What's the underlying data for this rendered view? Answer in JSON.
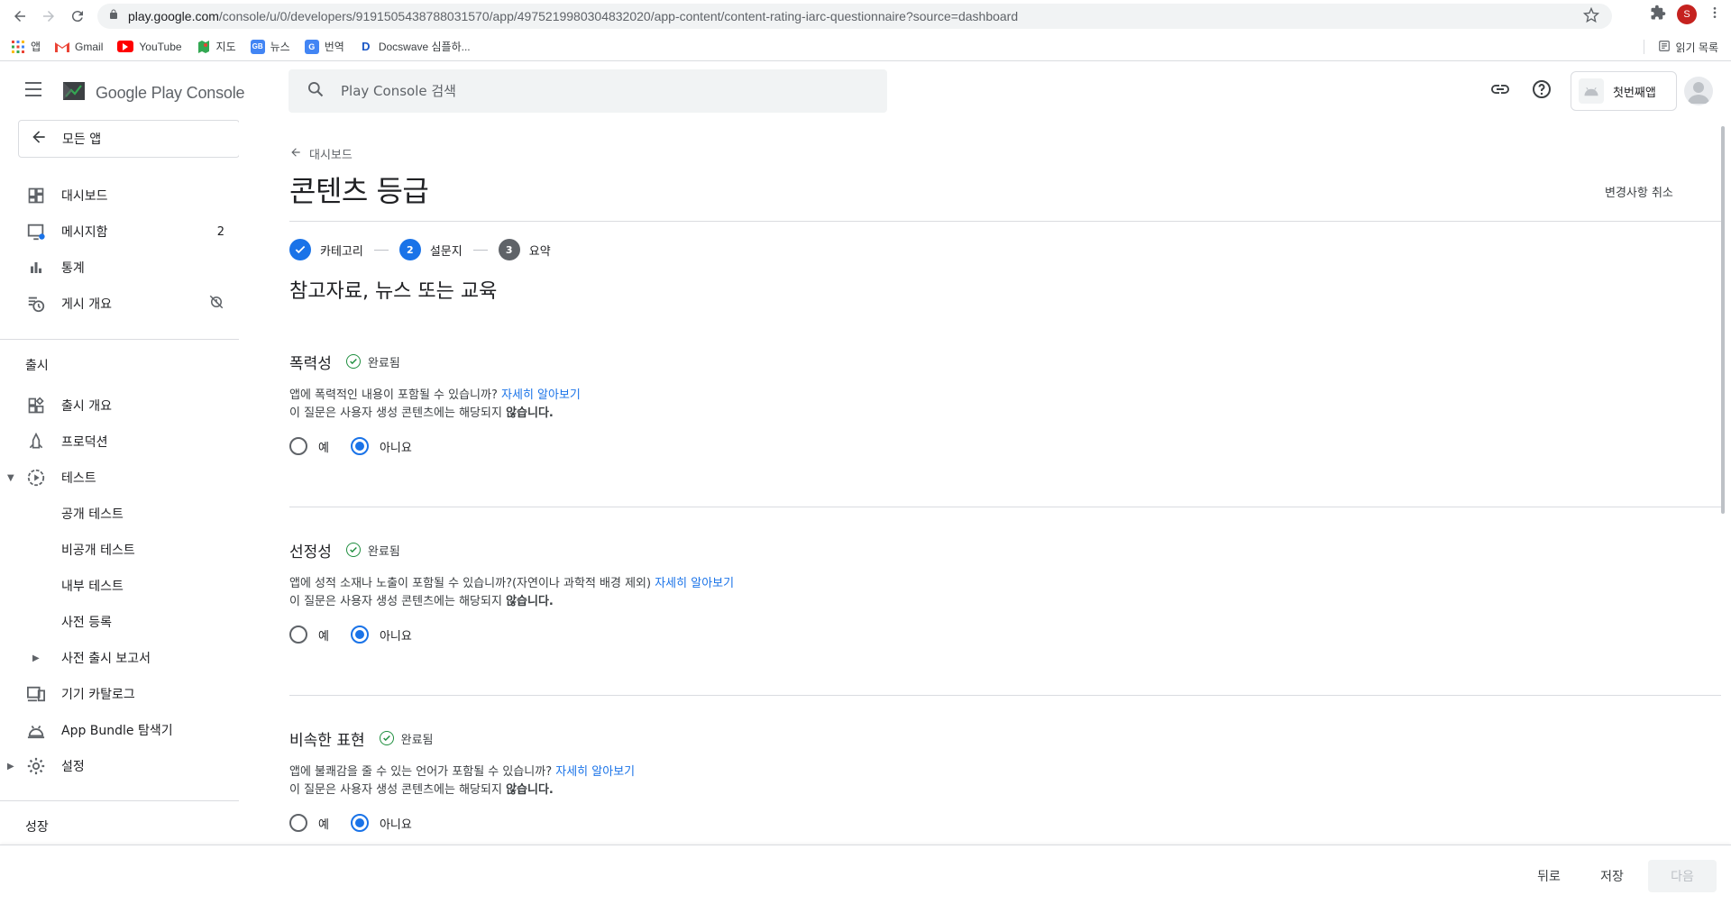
{
  "browser": {
    "url_domain": "play.google.com",
    "url_path": "/console/u/0/developers/9191505438788031570/app/4975219980304832020/app-content/content-rating-iarc-questionnaire?source=dashboard",
    "profile_initial": "S",
    "bookmarks": [
      {
        "label": "앱",
        "icon": "apps-grid-icon"
      },
      {
        "label": "Gmail",
        "icon": "gmail-icon"
      },
      {
        "label": "YouTube",
        "icon": "youtube-icon"
      },
      {
        "label": "지도",
        "icon": "maps-icon"
      },
      {
        "label": "뉴스",
        "icon": "news-icon"
      },
      {
        "label": "번역",
        "icon": "translate-icon"
      },
      {
        "label": "Docswave 심플하...",
        "icon": "docswave-icon"
      }
    ],
    "reading_list": "읽기 목록"
  },
  "header": {
    "logo_text": "Google Play Console",
    "search_placeholder": "Play Console 검색",
    "app_name": "첫번째앱"
  },
  "sidebar": {
    "back_label": "모든 앱",
    "items": [
      {
        "label": "대시보드",
        "icon": "dashboard-icon"
      },
      {
        "label": "메시지함",
        "icon": "inbox-icon",
        "badge": "2"
      },
      {
        "label": "통계",
        "icon": "bar-chart-icon"
      },
      {
        "label": "게시 개요",
        "icon": "publishing-overview-icon"
      }
    ],
    "release_section": "출시",
    "release_items": [
      {
        "label": "출시 개요",
        "icon": "release-overview-icon"
      },
      {
        "label": "프로덕션",
        "icon": "production-icon"
      },
      {
        "label": "테스트",
        "icon": "testing-icon"
      },
      {
        "label": "공개 테스트"
      },
      {
        "label": "비공개 테스트"
      },
      {
        "label": "내부 테스트"
      },
      {
        "label": "사전 등록"
      },
      {
        "label": "사전 출시 보고서"
      },
      {
        "label": "기기 카탈로그",
        "icon": "device-catalog-icon"
      },
      {
        "label": "App Bundle 탐색기",
        "icon": "app-bundle-icon"
      },
      {
        "label": "설정",
        "icon": "settings-gear-icon"
      }
    ],
    "growth_section": "성장"
  },
  "main": {
    "breadcrumb": "대시보드",
    "title": "콘텐츠 등급",
    "discard_label": "변경사항 취소",
    "steps": [
      {
        "label": "카테고리",
        "state": "done"
      },
      {
        "label": "설문지",
        "number": "2",
        "state": "current"
      },
      {
        "label": "요약",
        "number": "3",
        "state": "pending"
      }
    ],
    "section_title": "참고자료, 뉴스 또는 교육",
    "questions": [
      {
        "title": "폭력성",
        "status": "완료됨",
        "text": "앱에 폭력적인 내용이 포함될 수 있습니까?",
        "link": "자세히 알아보기",
        "note_prefix": "이 질문은 사용자 생성 콘텐츠에는 해당되지 ",
        "note_bold": "않습니다.",
        "yes": "예",
        "no": "아니요"
      },
      {
        "title": "선정성",
        "status": "완료됨",
        "text": "앱에 성적 소재나 노출이 포함될 수 있습니까?(자연이나 과학적 배경 제외)",
        "link": "자세히 알아보기",
        "note_prefix": "이 질문은 사용자 생성 콘텐츠에는 해당되지 ",
        "note_bold": "않습니다.",
        "yes": "예",
        "no": "아니요"
      },
      {
        "title": "비속한 표현",
        "status": "완료됨",
        "text": "앱에 불쾌감을 줄 수 있는 언어가 포함될 수 있습니까?",
        "link": "자세히 알아보기",
        "note_prefix": "이 질문은 사용자 생성 콘텐츠에는 해당되지 ",
        "note_bold": "않습니다.",
        "yes": "예",
        "no": "아니요"
      }
    ]
  },
  "footer": {
    "back_label": "뒤로",
    "save_label": "저장",
    "next_label": "다음"
  },
  "colors": {
    "accent": "#1a73e8",
    "complete_green": "#1e8e3e"
  }
}
